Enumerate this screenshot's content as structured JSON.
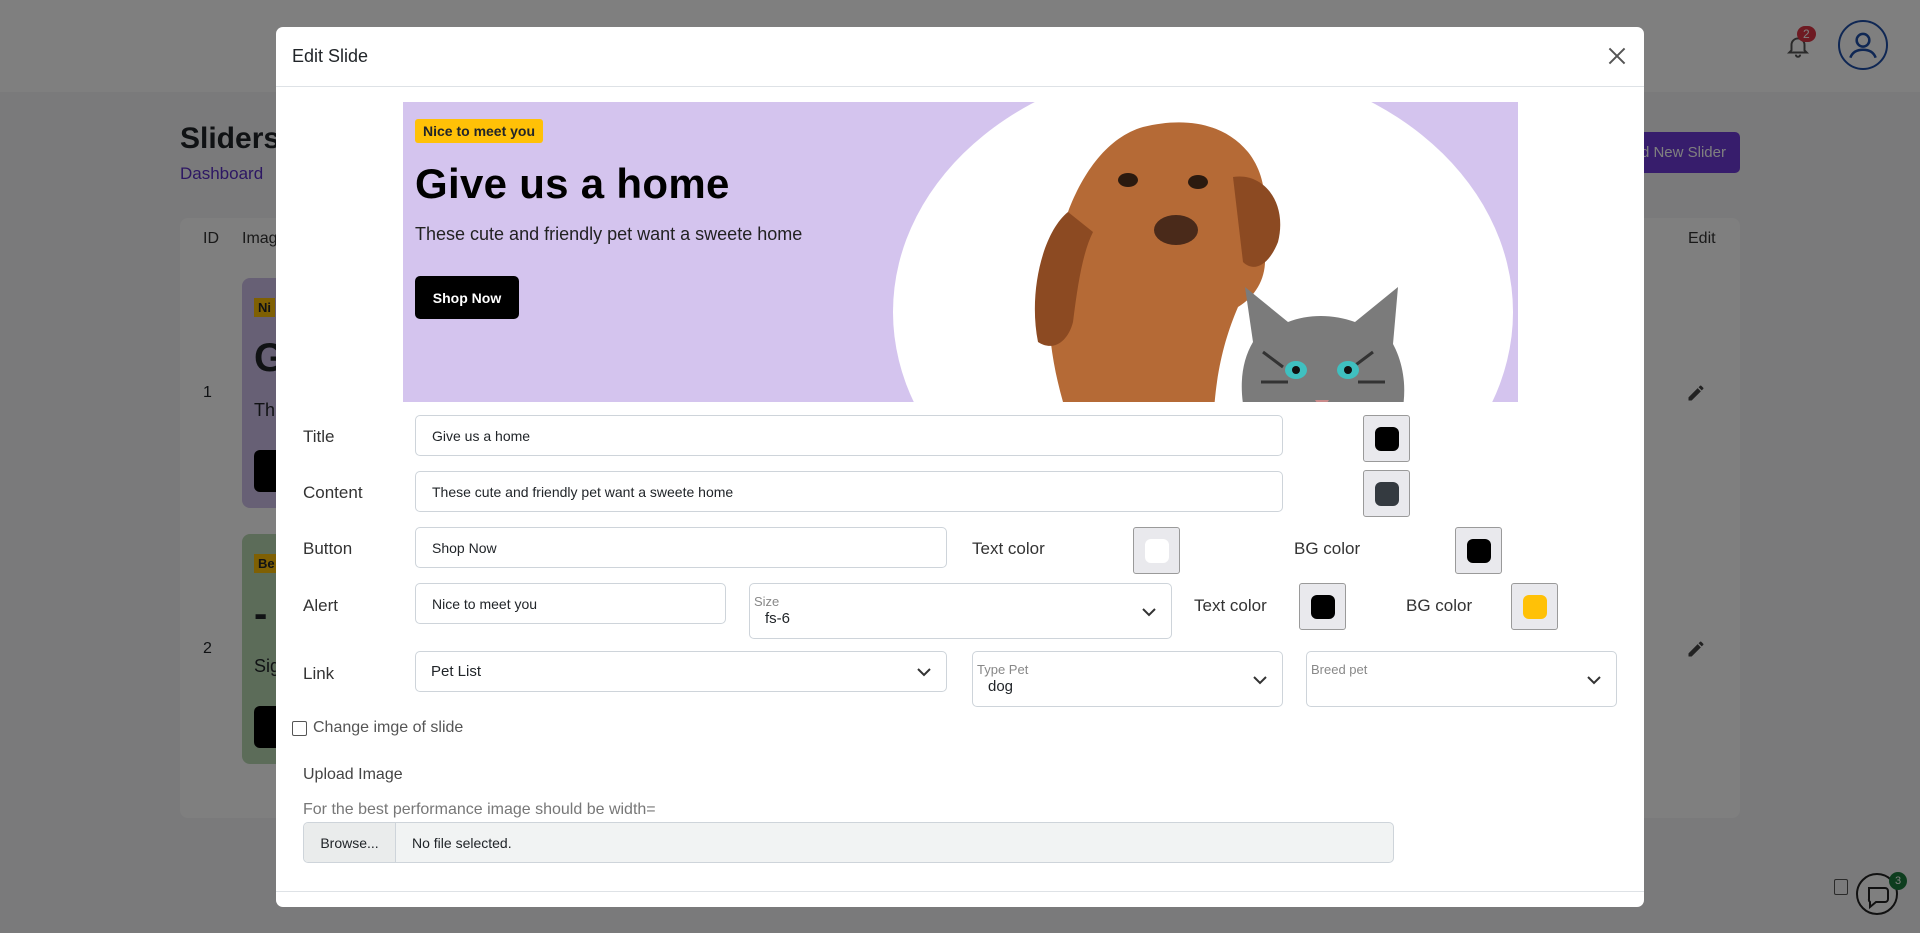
{
  "background": {
    "notifications_count": "2",
    "page_title": "Sliders",
    "breadcrumb": "Dashboard",
    "add_button_label": "d New Slider",
    "table_headers": {
      "id": "ID",
      "image": "Imag",
      "edit": "Edit"
    },
    "rows": [
      {
        "id": "1",
        "tag": "Ni",
        "big": "G",
        "text": "Th",
        "bg": "#cfc0ea"
      },
      {
        "id": "2",
        "tag": "Be",
        "big": "-",
        "text": "Sig",
        "bg": "#b9d8b3"
      }
    ],
    "chat_badge": "3"
  },
  "modal": {
    "title": "Edit Slide",
    "preview": {
      "alert": "Nice to meet you",
      "title": "Give us a home",
      "content": "These cute and friendly pet want a sweete home",
      "button": "Shop Now",
      "bg_color": "#d4c4ee"
    },
    "form": {
      "title_label": "Title",
      "title_value": "Give us a home",
      "title_color": "#000000",
      "content_label": "Content",
      "content_value": "These cute and friendly pet want a sweete home",
      "content_color": "#343a40",
      "button_label": "Button",
      "button_value": "Shop Now",
      "button_text_color_label": "Text color",
      "button_text_color": "#ffffff",
      "button_bg_color_label": "BG color",
      "button_bg_color": "#000000",
      "alert_label": "Alert",
      "alert_value": "Nice to meet you",
      "size_label": "Size",
      "size_value": "fs-6",
      "alert_text_color_label": "Text color",
      "alert_text_color": "#000000",
      "alert_bg_color_label": "BG color",
      "alert_bg_color": "#ffc107",
      "link_label": "Link",
      "link_value": "Pet List",
      "type_pet_label": "Type Pet",
      "type_pet_value": "dog",
      "breed_pet_label": "Breed pet",
      "breed_pet_value": "",
      "change_image_label": "Change imge of slide",
      "upload_label": "Upload Image",
      "upload_hint": "For the best performance image should be width=",
      "browse_label": "Browse...",
      "file_status": "No file selected."
    }
  }
}
